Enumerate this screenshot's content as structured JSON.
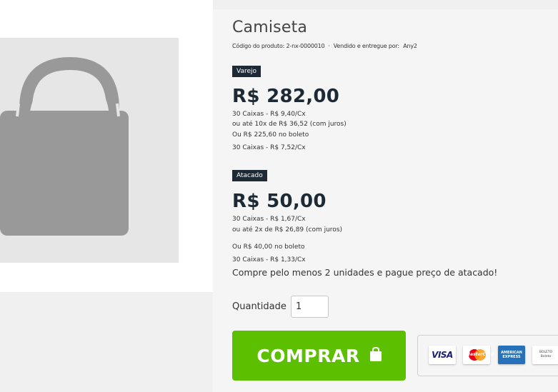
{
  "product": {
    "title": "Camiseta",
    "code_text": "Código do produto: 2-nx-0000010",
    "seller_text": "Vendido e entregue por:",
    "seller_name": "Any2"
  },
  "retail": {
    "badge": "Varejo",
    "price": "R$ 282,00",
    "lines": [
      "30 Caixas - R$ 9,40/Cx",
      "ou até 10x de R$ 36,52 (com juros)",
      "Ou R$ 225,60 no boleto",
      "30 Caixas - R$ 7,52/Cx"
    ]
  },
  "wholesale": {
    "badge": "Atacado",
    "price": "R$ 50,00",
    "lines": [
      "30 Caixas - R$ 1,67/Cx",
      "ou até 2x de R$ 26,89 (com juros)",
      "Ou R$ 40,00 no boleto",
      "30 Caixas - R$ 1,33/Cx"
    ],
    "promo": "Compre pelo menos 2 unidades e pague preço de atacado!"
  },
  "purchase": {
    "quantity_label": "Quantidade",
    "quantity_value": "1",
    "buy_label": "COMPRAR"
  },
  "payment_methods": {
    "visa": "VISA",
    "mastercard": "MasterCard",
    "amex_line1": "AMERICAN",
    "amex_line2": "EXPRESS",
    "boleto_line1": "BOLETO",
    "boleto_line2": "Boleto"
  },
  "icons": {
    "product_placeholder": "shopping-bag-icon",
    "buy": "bag-icon"
  },
  "colors": {
    "badge_bg": "#1d2a35",
    "price": "#1d2a35",
    "buy_button": "#5cbf00",
    "placeholder_bg": "#e6e6e6",
    "placeholder_icon": "#999999"
  }
}
